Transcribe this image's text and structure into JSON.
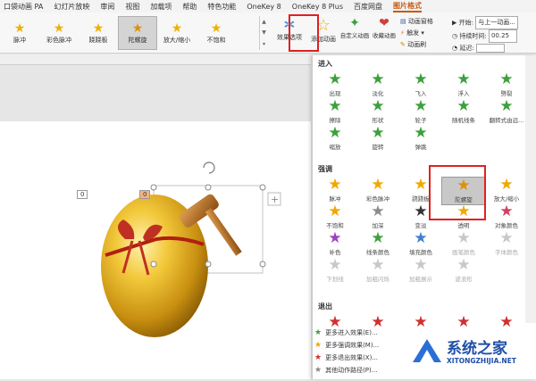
{
  "menu": [
    "口袋动画 PA",
    "幻灯片放映",
    "审阅",
    "视图",
    "加载项",
    "帮助",
    "特色功能",
    "OneKey 8",
    "OneKey 8 Plus",
    "百度网盘",
    "图片格式"
  ],
  "ribbon": {
    "gallery": [
      {
        "label": "脉冲",
        "icon": "★",
        "color": "#f0b000"
      },
      {
        "label": "彩色脉冲",
        "icon": "★",
        "color": "#f0b000"
      },
      {
        "label": "跷跷板",
        "icon": "★",
        "color": "#f0b000"
      },
      {
        "label": "陀螺旋",
        "icon": "★",
        "color": "#e09000"
      },
      {
        "label": "放大/缩小",
        "icon": "★",
        "color": "#f0b000"
      },
      {
        "label": "不饱和",
        "icon": "★",
        "color": "#f0b000"
      }
    ],
    "effect_options": "效果选项",
    "add_animation": "添加动画",
    "custom_animation": "自定义动画",
    "collect_animation": "收藏动画",
    "animation_pane": "动画窗格",
    "trigger": "触发",
    "animation_painter": "动画刷",
    "start_label": "开始:",
    "start_value": "与上一动画...",
    "duration_label": "持续时间:",
    "duration_value": "00.25",
    "delay_label": "延迟:",
    "delay_value": "",
    "group_label": "动画"
  },
  "panel": {
    "sections": {
      "entrance": "进入",
      "emphasis": "强调",
      "exit": "退出"
    },
    "entrance": [
      {
        "label": "出现",
        "color": "#3ca03c"
      },
      {
        "label": "淡化",
        "color": "#3ca03c"
      },
      {
        "label": "飞入",
        "color": "#3ca03c"
      },
      {
        "label": "浮入",
        "color": "#3ca03c"
      },
      {
        "label": "劈裂",
        "color": "#3ca03c"
      },
      {
        "label": "擦除",
        "color": "#3ca03c"
      },
      {
        "label": "形状",
        "color": "#3ca03c"
      },
      {
        "label": "轮子",
        "color": "#3ca03c"
      },
      {
        "label": "随机线条",
        "color": "#3ca03c"
      },
      {
        "label": "翻转式由远...",
        "color": "#3ca03c"
      },
      {
        "label": "缩放",
        "color": "#3ca03c"
      },
      {
        "label": "旋转",
        "color": "#3ca03c"
      },
      {
        "label": "弹跳",
        "color": "#3ca03c"
      }
    ],
    "emphasis": [
      {
        "label": "脉冲",
        "color": "#f0a800",
        "dim": false
      },
      {
        "label": "彩色脉冲",
        "color": "#f0a800",
        "dim": false
      },
      {
        "label": "跷跷板",
        "color": "#f0a800",
        "dim": false
      },
      {
        "label": "陀螺旋",
        "color": "#e09000",
        "dim": false
      },
      {
        "label": "放大/缩小",
        "color": "#f0a800",
        "dim": false
      },
      {
        "label": "不饱和",
        "color": "#f0a800",
        "dim": false
      },
      {
        "label": "加深",
        "color": "#8a8a8a",
        "dim": false
      },
      {
        "label": "变淡",
        "color": "#333333",
        "dim": false
      },
      {
        "label": "透明",
        "color": "#f0a800",
        "dim": false
      },
      {
        "label": "对象颜色",
        "color": "#d04060",
        "dim": false
      },
      {
        "label": "补色",
        "color": "#a040c0",
        "dim": false
      },
      {
        "label": "线条颜色",
        "color": "#40a040",
        "dim": false
      },
      {
        "label": "填充颜色",
        "color": "#4080d0",
        "dim": false
      },
      {
        "label": "画笔颜色",
        "color": "#c8c8c8",
        "dim": true
      },
      {
        "label": "字体颜色",
        "color": "#c8c8c8",
        "dim": true
      },
      {
        "label": "下划线",
        "color": "#c8c8c8",
        "dim": true
      },
      {
        "label": "加粗闪烁",
        "color": "#c8c8c8",
        "dim": true
      },
      {
        "label": "加粗展示",
        "color": "#c8c8c8",
        "dim": true
      },
      {
        "label": "波浪形",
        "color": "#c8c8c8",
        "dim": true
      }
    ],
    "exit": [
      {
        "label": "",
        "color": "#d03030"
      },
      {
        "label": "",
        "color": "#d03030"
      },
      {
        "label": "",
        "color": "#d03030"
      },
      {
        "label": "",
        "color": "#d03030"
      },
      {
        "label": "",
        "color": "#d03030"
      }
    ],
    "more": [
      {
        "label": "更多进入效果(E)...",
        "color": "#3ca03c"
      },
      {
        "label": "更多强调效果(M)...",
        "color": "#f0a800"
      },
      {
        "label": "更多退出效果(X)...",
        "color": "#d03030"
      },
      {
        "label": "其他动作路径(P)...",
        "color": "#888888"
      }
    ]
  },
  "slide": {
    "tag_left": "0",
    "tag_top": "0"
  },
  "watermark": {
    "title": "系统之家",
    "url": "XITONGZHIJIA.NET"
  },
  "colors": {
    "accent": "#c55a11",
    "highlight_box": "#e02020"
  }
}
